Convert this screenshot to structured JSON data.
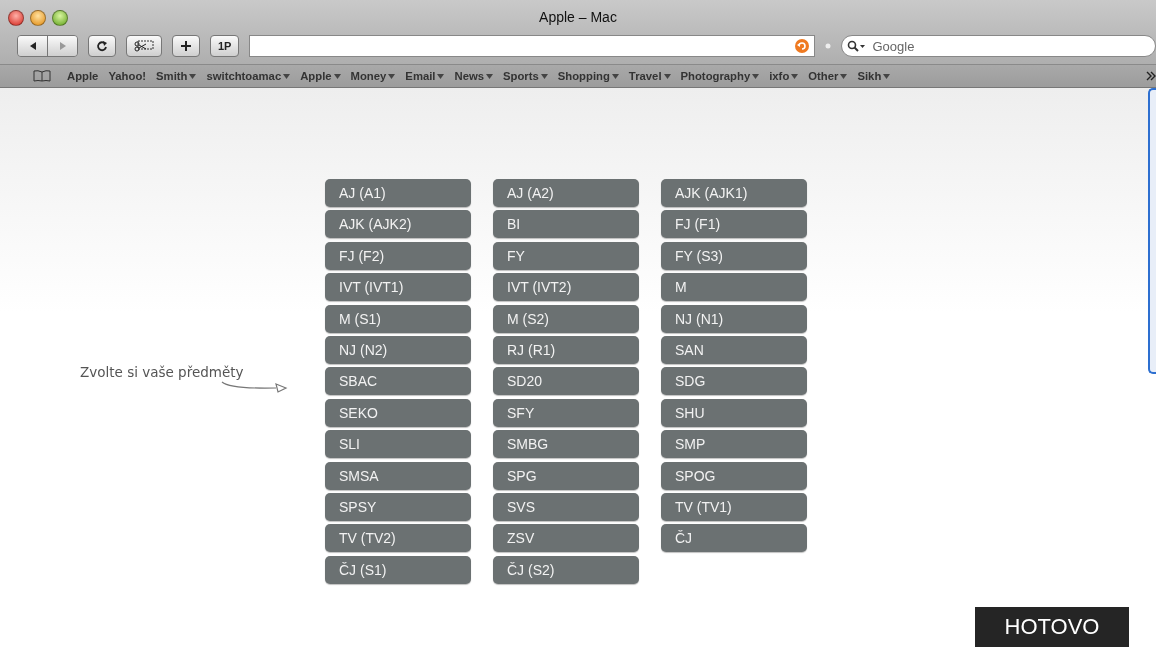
{
  "window": {
    "title": "Apple – Mac"
  },
  "toolbar": {
    "buttons": [
      "1P"
    ],
    "search": {
      "placeholder": "Google"
    }
  },
  "bookmarks": [
    {
      "label": "Apple",
      "menu": false
    },
    {
      "label": "Yahoo!",
      "menu": false
    },
    {
      "label": "Smith",
      "menu": true
    },
    {
      "label": "switchtoamac",
      "menu": true
    },
    {
      "label": "Apple",
      "menu": true
    },
    {
      "label": "Money",
      "menu": true
    },
    {
      "label": "Email",
      "menu": true
    },
    {
      "label": "News",
      "menu": true
    },
    {
      "label": "Sports",
      "menu": true
    },
    {
      "label": "Shopping",
      "menu": true
    },
    {
      "label": "Travel",
      "menu": true
    },
    {
      "label": "Photography",
      "menu": true
    },
    {
      "label": "ixfo",
      "menu": true
    },
    {
      "label": "Other",
      "menu": true
    },
    {
      "label": "Sikh",
      "menu": true
    }
  ],
  "prompt": "Zvolte si vaše předměty",
  "subject_columns": [
    [
      "AJ (A1)",
      "AJK (AJK2)",
      "FJ (F2)",
      "IVT (IVT1)",
      "M (S1)",
      "NJ (N2)",
      "SBAC",
      "SEKO",
      "SLI",
      "SMSA",
      "SPSY",
      "TV (TV2)",
      "ČJ (S1)"
    ],
    [
      "AJ (A2)",
      "BI",
      "FY",
      "IVT (IVT2)",
      "M (S2)",
      "RJ (R1)",
      "SD20",
      "SFY",
      "SMBG",
      "SPG",
      "SVS",
      "ZSV",
      "ČJ (S2)"
    ],
    [
      "AJK (AJK1)",
      "FJ (F1)",
      "FY (S3)",
      "M",
      "NJ (N1)",
      "SAN",
      "SDG",
      "SHU",
      "SMP",
      "SPOG",
      "TV (TV1)",
      "ČJ"
    ]
  ],
  "done_button": "HOTOVO"
}
